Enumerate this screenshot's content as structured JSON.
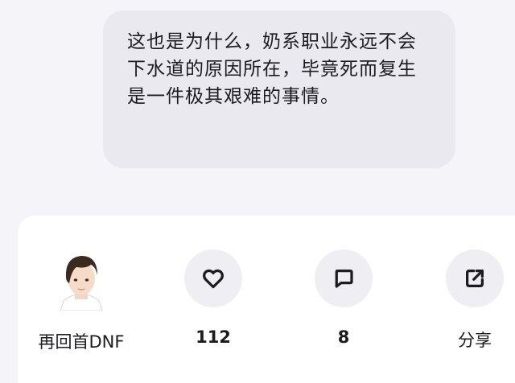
{
  "message": {
    "text": "这也是为什么，奶系职业永远不会下水道的原因所在，毕竟死而复生是一件极其艰难的事情。"
  },
  "actions": {
    "author_name": "再回首DNF",
    "like_count": "112",
    "comment_count": "8",
    "share_label": "分享"
  },
  "colors": {
    "background": "#f5f5f9",
    "bubble": "#e9e9ef",
    "icon_circle": "#eeeef3",
    "text": "#1c1c1e"
  },
  "icons": {
    "like": "heart-icon",
    "comment": "comment-bubble-icon",
    "share": "share-arrow-icon"
  }
}
